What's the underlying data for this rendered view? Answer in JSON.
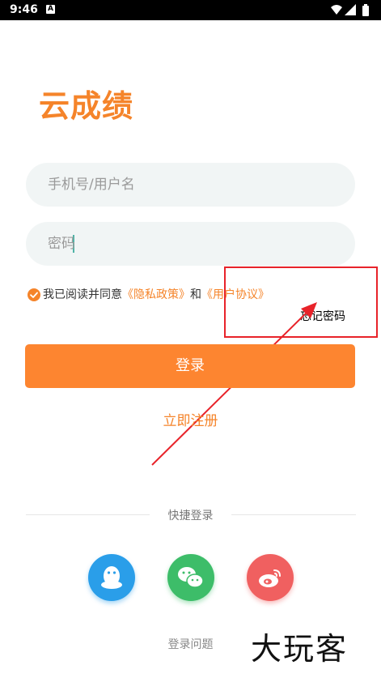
{
  "status_bar": {
    "time": "9:46",
    "notification_icon": "A"
  },
  "logo": {
    "text": "云成绩"
  },
  "form": {
    "username": {
      "placeholder": "手机号/用户名",
      "value": ""
    },
    "password": {
      "placeholder": "密码",
      "value": ""
    }
  },
  "agreement": {
    "checked": true,
    "prefix": "我已阅读并同意",
    "privacy_link": "《隐私政策》",
    "and": "和",
    "terms_link": "《用户协议》"
  },
  "forgot_password": "忘记密码",
  "login_button": "登录",
  "register_link": "立即注册",
  "quick_login": {
    "label": "快捷登录",
    "providers": [
      "qq-icon",
      "wechat-icon",
      "weibo-icon"
    ]
  },
  "login_problem": "登录问题",
  "watermark": "大玩客",
  "colors": {
    "accent": "#fd8530",
    "qq": "#2a9ee9",
    "wechat": "#3dbd69",
    "weibo": "#f06060",
    "annotation": "#e8232a"
  }
}
